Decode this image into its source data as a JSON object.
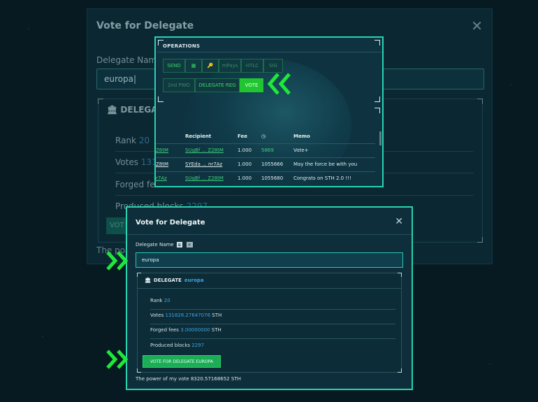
{
  "background_modal": {
    "title": "Vote for Delegate",
    "delegate_label": "Delegate Name",
    "input_value": "europa",
    "delegate_header": "DELEGATE",
    "rank_label": "Rank",
    "rank_value": "20",
    "votes_label": "Votes",
    "votes_value": "131",
    "forged_label": "Forged fee",
    "produced_label": "Produced blocks",
    "produced_value": "2297",
    "vote_btn": "VOT",
    "power_label": "The po"
  },
  "operations": {
    "title": "OPERATIONS",
    "row1": [
      "SEND",
      "",
      "",
      "mPays",
      "HTLC",
      "SIG"
    ],
    "row2": [
      "2nd PWD",
      "DELEGATE REG",
      "VOTE"
    ],
    "active": "VOTE",
    "columns": [
      "Recipient",
      "Fee",
      "",
      "Memo"
    ],
    "rows": [
      {
        "sender": "Z6tM",
        "recipient": "SUgBf ... Z28tM",
        "fee": "1.000",
        "num": "5869",
        "memo": "Vote+"
      },
      {
        "sender": "Z8tM",
        "recipient": "SYEda ... nr7Az",
        "fee": "1.000",
        "num": "1055666",
        "memo": "May the force be with you"
      },
      {
        "sender": "r7Az",
        "recipient": "SUgBf ... Z28tM",
        "fee": "1.000",
        "num": "1055680",
        "memo": "Congrats on STH 2.0 !!!"
      }
    ]
  },
  "modal": {
    "title": "Vote for Delegate",
    "delegate_label": "Delegate Name",
    "input_value": "europa",
    "delegate_header": "DELEGATE",
    "delegate_name": "europa",
    "rank_label": "Rank",
    "rank_value": "20",
    "votes_label": "Votes",
    "votes_value": "131828.27647076",
    "votes_unit": "STH",
    "forged_label": "Forged fees",
    "forged_value": "3.00000000",
    "forged_unit": "STH",
    "produced_label": "Produced blocks",
    "produced_value": "2297",
    "vote_button": "VOTE FOR DELEGATE EUROPA",
    "power_text": "The power of my vote 8320.57168652 STH"
  },
  "colors": {
    "accent": "#27d3b0",
    "green": "#21c431",
    "blue": "#3fa3e3"
  },
  "icons": [
    "close-icon",
    "bank-icon",
    "qr-icon",
    "key-icon",
    "clock-icon",
    "arrow-indicator"
  ]
}
